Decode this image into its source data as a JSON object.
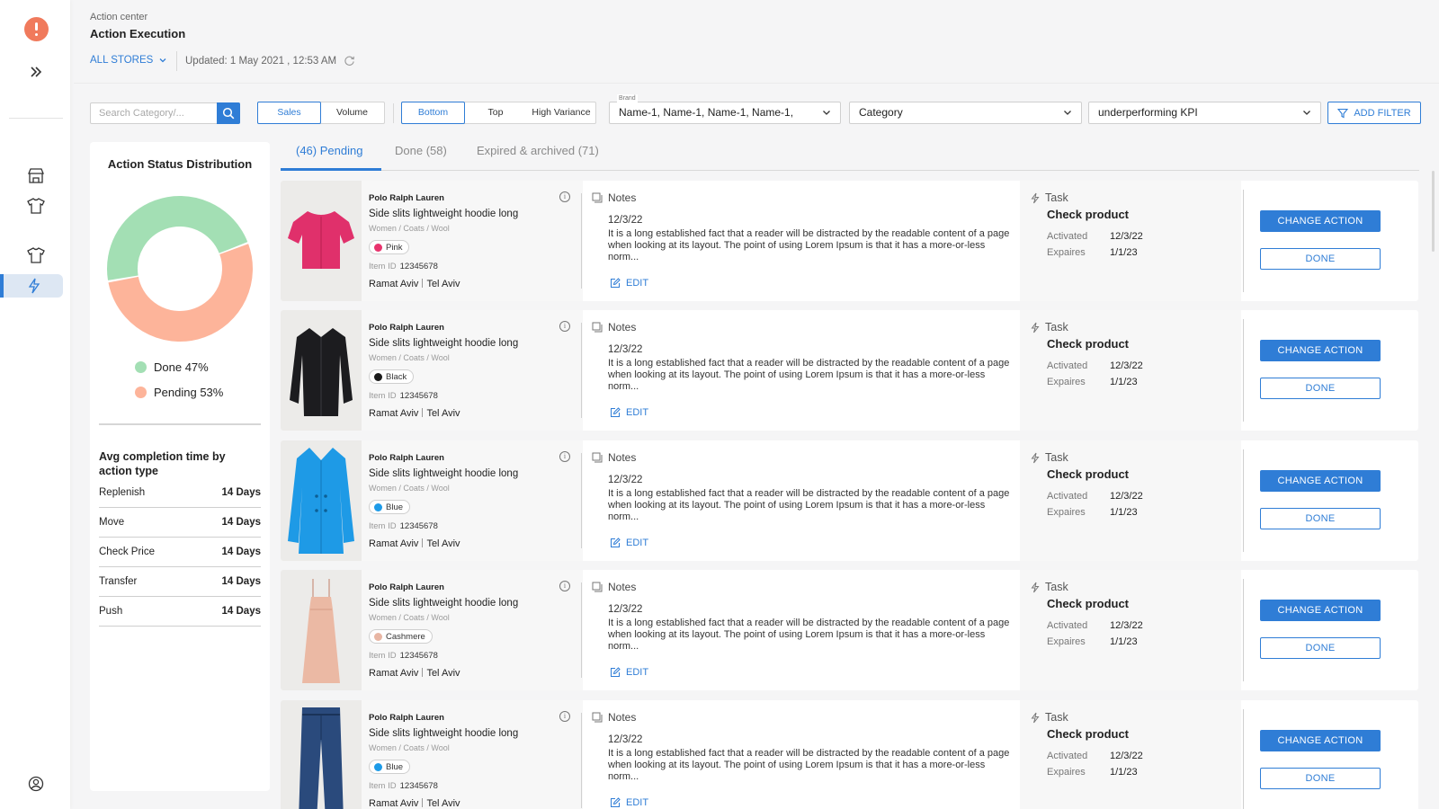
{
  "header": {
    "breadcrumb": "Action center",
    "title": "Action Execution",
    "stores": "ALL STORES",
    "updated": "Updated: 1 May 2021 , 12:53 AM"
  },
  "filters": {
    "search_placeholder": "Search Category/...",
    "metric": {
      "options": [
        "Sales",
        "Volume"
      ],
      "selected": "Sales"
    },
    "rank": {
      "options": [
        "Bottom",
        "Top",
        "High Variance"
      ],
      "selected": "Bottom"
    },
    "brand": {
      "label": "Brand",
      "value": "Name-1,  Name-1, Name-1, Name-1,"
    },
    "category": {
      "value": "Category"
    },
    "kpi": {
      "value": "underperforming KPI"
    },
    "add_filter": "ADD FILTER"
  },
  "status_panel": {
    "title": "Action Status Distribution",
    "done": {
      "label": "Done 47%",
      "value": 47,
      "color": "#a3dfb4"
    },
    "pending": {
      "label": "Pending 53%",
      "value": 53,
      "color": "#fdb49a"
    },
    "avg_title": "Avg completion time by action type",
    "avg_rows": [
      {
        "name": "Replenish",
        "value": "14 Days"
      },
      {
        "name": "Move",
        "value": "14 Days"
      },
      {
        "name": "Check Price",
        "value": "14 Days"
      },
      {
        "name": "Transfer",
        "value": "14 Days"
      },
      {
        "name": "Push",
        "value": "14 Days"
      }
    ]
  },
  "tabs": [
    {
      "label": "(46) Pending",
      "active": true
    },
    {
      "label": "Done (58)",
      "active": false
    },
    {
      "label": "Expired & archived (71)",
      "active": false
    }
  ],
  "card_labels": {
    "notes": "Notes",
    "edit": "EDIT",
    "task": "Task",
    "activated": "Activated",
    "expires": "Expaires",
    "change_action": "CHANGE ACTION",
    "done": "DONE",
    "item_id_label": "Item ID"
  },
  "cards": [
    {
      "brand": "Polo Ralph Lauren",
      "name": "Side slits lightweight hoodie long",
      "category": "Women / Coats / Wool",
      "color_name": "Pink",
      "color_hex": "#e8336d",
      "item_id": "12345678",
      "store": "Ramat Aviv",
      "city": "Tel Aviv",
      "note_date": "12/3/22",
      "note": "It is a long established fact that a reader will be distracted by the readable content of a page when looking at its layout. The point of using Lorem Ipsum is that it has a more-or-less norm...",
      "task": "Check product",
      "activated": "12/3/22",
      "expires": "1/1/23",
      "product_icon": "pink-shirt-icon"
    },
    {
      "brand": "Polo Ralph Lauren",
      "name": "Side slits lightweight hoodie long",
      "category": "Women / Coats / Wool",
      "color_name": "Black",
      "color_hex": "#1b1b1b",
      "item_id": "12345678",
      "store": "Ramat Aviv",
      "city": "Tel Aviv",
      "note_date": "12/3/22",
      "note": "It is a long established fact that a reader will be distracted by the readable content of a page when looking at its layout. The point of using Lorem Ipsum is that it has a more-or-less norm...",
      "task": "Check product",
      "activated": "12/3/22",
      "expires": "1/1/23",
      "product_icon": "black-shirt-icon"
    },
    {
      "brand": "Polo Ralph Lauren",
      "name": "Side slits lightweight hoodie long",
      "category": "Women / Coats / Wool",
      "color_name": "Blue",
      "color_hex": "#1d9be8",
      "item_id": "12345678",
      "store": "Ramat Aviv",
      "city": "Tel Aviv",
      "note_date": "12/3/22",
      "note": "It is a long established fact that a reader will be distracted by the readable content of a page when looking at its layout. The point of using Lorem Ipsum is that it has a more-or-less norm...",
      "task": "Check product",
      "activated": "12/3/22",
      "expires": "1/1/23",
      "product_icon": "blue-coat-icon"
    },
    {
      "brand": "Polo Ralph Lauren",
      "name": "Side slits lightweight hoodie long",
      "category": "Women / Coats / Wool",
      "color_name": "Cashmere",
      "color_hex": "#e8b6a4",
      "item_id": "12345678",
      "store": "Ramat Aviv",
      "city": "Tel Aviv",
      "note_date": "12/3/22",
      "note": "It is a long established fact that a reader will be distracted by the readable content of a page when looking at its layout. The point of using Lorem Ipsum is that it has a more-or-less norm...",
      "task": "Check product",
      "activated": "12/3/22",
      "expires": "1/1/23",
      "product_icon": "cashmere-dress-icon"
    },
    {
      "brand": "Polo Ralph Lauren",
      "name": "Side slits lightweight hoodie long",
      "category": "Women / Coats / Wool",
      "color_name": "Blue",
      "color_hex": "#1d9be8",
      "item_id": "12345678",
      "store": "Ramat Aviv",
      "city": "Tel Aviv",
      "note_date": "12/3/22",
      "note": "It is a long established fact that a reader will be distracted by the readable content of a page when looking at its layout. The point of using Lorem Ipsum is that it has a more-or-less norm...",
      "task": "Check product",
      "activated": "12/3/22",
      "expires": "1/1/23",
      "product_icon": "jeans-icon"
    }
  ],
  "icons": {
    "logo": "alert-logo-icon",
    "expand": "double-chevron-right-icon",
    "nav": [
      "store-icon",
      "shirt-icon",
      "shirt-icon",
      "lightning-icon"
    ],
    "profile": "user-circle-icon"
  }
}
